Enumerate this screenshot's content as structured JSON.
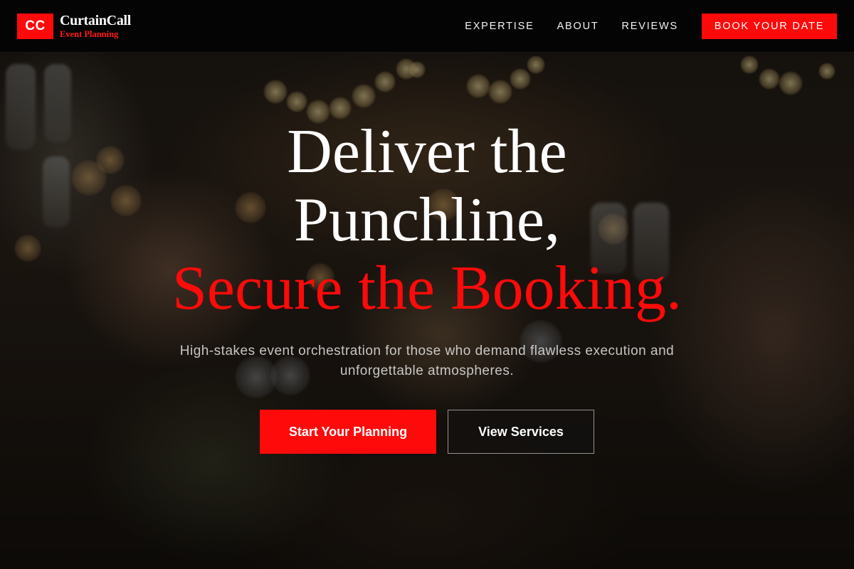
{
  "brand": {
    "mark": "CC",
    "name": "CurtainCall",
    "subtitle": "Event Planning"
  },
  "nav": {
    "links": [
      "EXPERTISE",
      "ABOUT",
      "REVIEWS"
    ],
    "cta_label": "BOOK YOUR DATE"
  },
  "hero": {
    "headline_line1": "Deliver the",
    "headline_line2": "Punchline,",
    "headline_accent": "Secure the Booking.",
    "subtext": "High-stakes event orchestration for those who demand flawless execution and unforgettable atmospheres.",
    "primary_cta": "Start Your Planning",
    "secondary_cta": "View Services"
  },
  "colors": {
    "accent": "#ff0a0a",
    "navbar_bg": "#040404",
    "text_light": "#ffffff"
  }
}
